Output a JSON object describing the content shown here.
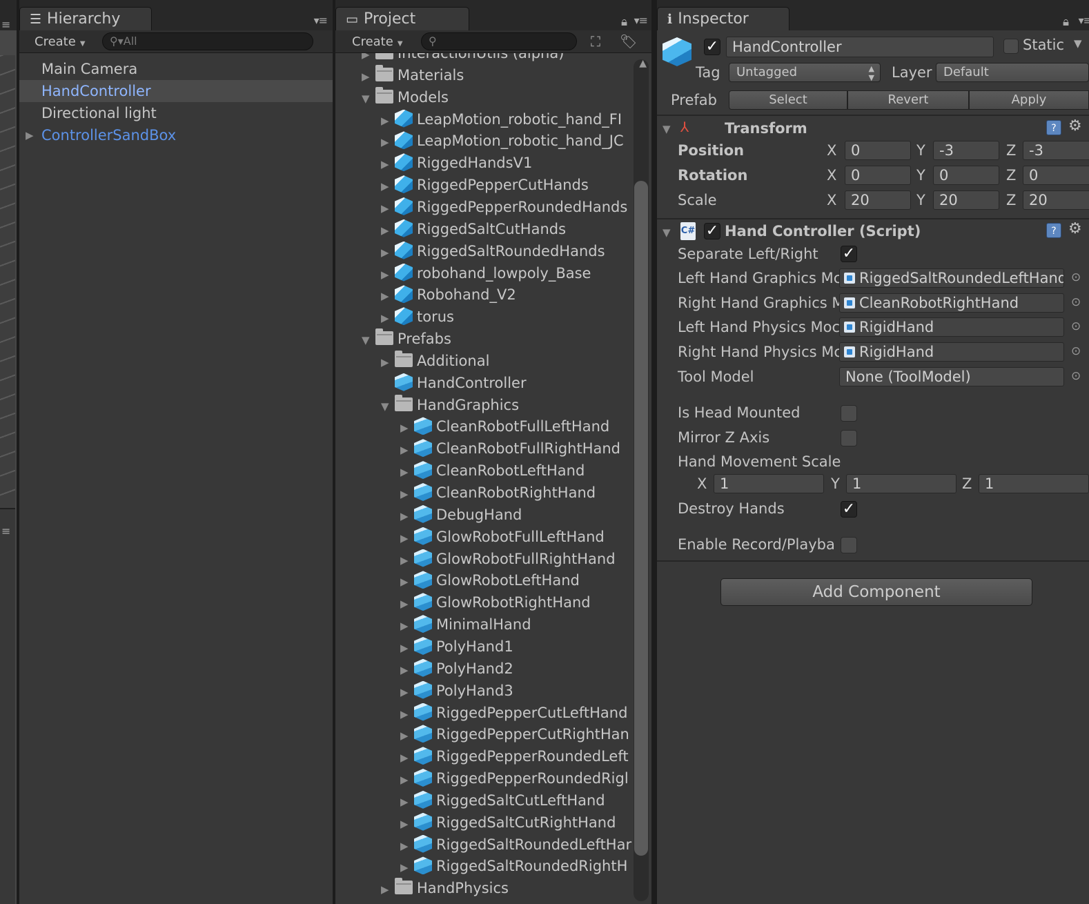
{
  "hierarchy": {
    "tab_label": "Hierarchy",
    "create_label": "Create",
    "search_placeholder": "All",
    "items": [
      {
        "label": "Main Camera"
      },
      {
        "label": "HandController"
      },
      {
        "label": "Directional light"
      },
      {
        "label": "ControllerSandBox"
      }
    ]
  },
  "project": {
    "tab_label": "Project",
    "create_label": "Create",
    "items": [
      {
        "label": "InteractionUtils (alpha)",
        "icon": "folder-icon"
      },
      {
        "label": "Materials",
        "icon": "folder-icon"
      },
      {
        "label": "Models",
        "icon": "folder-icon"
      },
      {
        "label": "LeapMotion_robotic_hand_FI",
        "icon": "model-icon"
      },
      {
        "label": "LeapMotion_robotic_hand_JC",
        "icon": "model-icon"
      },
      {
        "label": "RiggedHandsV1",
        "icon": "model-icon"
      },
      {
        "label": "RiggedPepperCutHands",
        "icon": "model-icon"
      },
      {
        "label": "RiggedPepperRoundedHands",
        "icon": "model-icon"
      },
      {
        "label": "RiggedSaltCutHands",
        "icon": "model-icon"
      },
      {
        "label": "RiggedSaltRoundedHands",
        "icon": "model-icon"
      },
      {
        "label": "robohand_lowpoly_Base",
        "icon": "model-icon"
      },
      {
        "label": "Robohand_V2",
        "icon": "model-icon"
      },
      {
        "label": "torus",
        "icon": "model-icon"
      },
      {
        "label": "Prefabs",
        "icon": "folder-icon"
      },
      {
        "label": "Additional",
        "icon": "folder-icon"
      },
      {
        "label": "HandController",
        "icon": "prefab-icon"
      },
      {
        "label": "HandGraphics",
        "icon": "folder-icon"
      },
      {
        "label": "CleanRobotFullLeftHand",
        "icon": "prefab-icon"
      },
      {
        "label": "CleanRobotFullRightHand",
        "icon": "prefab-icon"
      },
      {
        "label": "CleanRobotLeftHand",
        "icon": "prefab-icon"
      },
      {
        "label": "CleanRobotRightHand",
        "icon": "prefab-icon"
      },
      {
        "label": "DebugHand",
        "icon": "prefab-icon"
      },
      {
        "label": "GlowRobotFullLeftHand",
        "icon": "prefab-icon"
      },
      {
        "label": "GlowRobotFullRightHand",
        "icon": "prefab-icon"
      },
      {
        "label": "GlowRobotLeftHand",
        "icon": "prefab-icon"
      },
      {
        "label": "GlowRobotRightHand",
        "icon": "prefab-icon"
      },
      {
        "label": "MinimalHand",
        "icon": "prefab-icon"
      },
      {
        "label": "PolyHand1",
        "icon": "prefab-icon"
      },
      {
        "label": "PolyHand2",
        "icon": "prefab-icon"
      },
      {
        "label": "PolyHand3",
        "icon": "prefab-icon"
      },
      {
        "label": "RiggedPepperCutLeftHand",
        "icon": "prefab-icon"
      },
      {
        "label": "RiggedPepperCutRightHan",
        "icon": "prefab-icon"
      },
      {
        "label": "RiggedPepperRoundedLeft",
        "icon": "prefab-icon"
      },
      {
        "label": "RiggedPepperRoundedRigl",
        "icon": "prefab-icon"
      },
      {
        "label": "RiggedSaltCutLeftHand",
        "icon": "prefab-icon"
      },
      {
        "label": "RiggedSaltCutRightHand",
        "icon": "prefab-icon"
      },
      {
        "label": "RiggedSaltRoundedLeftHar",
        "icon": "prefab-icon"
      },
      {
        "label": "RiggedSaltRoundedRightH",
        "icon": "prefab-icon"
      },
      {
        "label": "HandPhysics",
        "icon": "folder-icon"
      }
    ]
  },
  "inspector": {
    "tab_label": "Inspector",
    "object_name": "HandController",
    "static_label": "Static",
    "tag_label": "Tag",
    "tag_value": "Untagged",
    "layer_label": "Layer",
    "layer_value": "Default",
    "prefab_label": "Prefab",
    "prefab_select": "Select",
    "prefab_revert": "Revert",
    "prefab_apply": "Apply",
    "transform": {
      "title": "Transform",
      "position_label": "Position",
      "rotation_label": "Rotation",
      "scale_label": "Scale",
      "x": "X",
      "y": "Y",
      "z": "Z",
      "position": [
        "0",
        "-3",
        "-3"
      ],
      "rotation": [
        "0",
        "0",
        "0"
      ],
      "scale": [
        "20",
        "20",
        "20"
      ]
    },
    "script": {
      "title": "Hand Controller (Script)",
      "separate_label": "Separate Left/Right",
      "left_graphics_label": "Left Hand Graphics Mc",
      "left_graphics_value": "RiggedSaltRoundedLeftHand",
      "right_graphics_label": "Right Hand Graphics M",
      "right_graphics_value": "CleanRobotRightHand",
      "left_physics_label": "Left Hand Physics Moc",
      "left_physics_value": "RigidHand",
      "right_physics_label": "Right Hand Physics Mc",
      "right_physics_value": "RigidHand",
      "tool_label": "Tool Model",
      "tool_value": "None (ToolModel)",
      "head_mounted_label": "Is Head Mounted",
      "mirror_label": "Mirror Z Axis",
      "movement_scale_label": "Hand Movement Scale",
      "movement_scale": [
        "1",
        "1",
        "1"
      ],
      "destroy_label": "Destroy Hands",
      "record_label": "Enable Record/Playba"
    },
    "add_component": "Add Component"
  }
}
